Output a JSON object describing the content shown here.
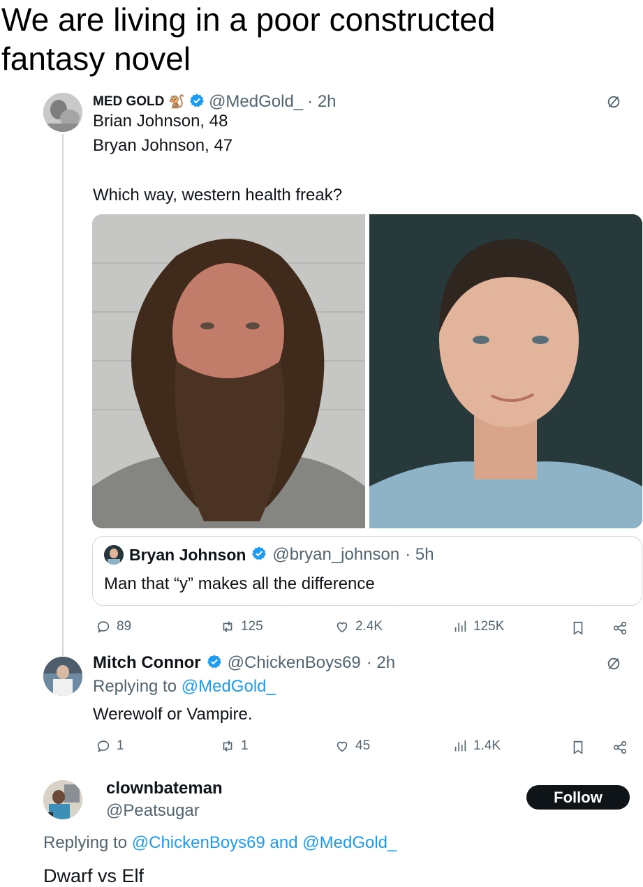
{
  "caption": {
    "line1": "We are living in a poor constructed",
    "line2": "fantasy novel"
  },
  "tweet1": {
    "display_name": "MED GOLD",
    "emoji": "🐒",
    "handle": "@MedGold_",
    "time": "· 2h",
    "lines": [
      "Brian Johnson, 48",
      "Bryan Johnson, 47",
      "Which way, western health freak?"
    ],
    "quote": {
      "display_name": "Bryan Johnson",
      "handle": "@bryan_johnson",
      "time": "· 5h",
      "text": "Man that “y” makes all the difference"
    },
    "actions": {
      "replies": "89",
      "reposts": "125",
      "likes": "2.4K",
      "views": "125K"
    }
  },
  "tweet2": {
    "display_name": "Mitch Connor",
    "handle": "@ChickenBoys69",
    "time": "· 2h",
    "replying_prefix": "Replying to",
    "replying_to": "@MedGold_",
    "text": "Werewolf or Vampire.",
    "actions": {
      "replies": "1",
      "reposts": "1",
      "likes": "45",
      "views": "1.4K"
    }
  },
  "tweet3": {
    "display_name": "clownbateman",
    "handle": "@Peatsugar",
    "follow_label": "Follow",
    "replying_prefix": "Replying to",
    "replying_to_1": "@ChickenBoys69",
    "replying_and": "and",
    "replying_to_2": "@MedGold_",
    "text": "Dwarf vs Elf"
  },
  "colors": {
    "accent": "#1d9bf0",
    "verified": "#1d9bf0",
    "secondary_text": "#536471",
    "follow_bg": "#0f1419"
  }
}
